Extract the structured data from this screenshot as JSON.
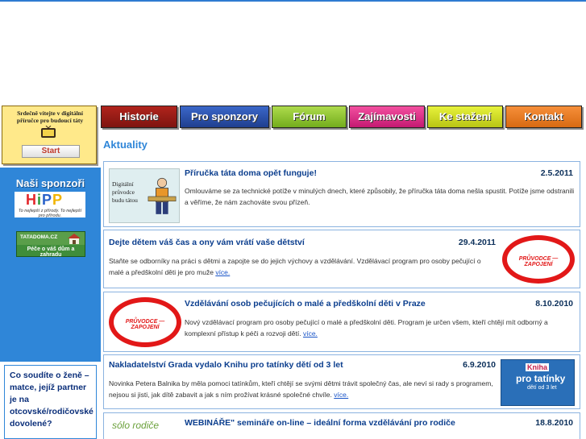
{
  "welcome": {
    "text": "Srdečně vítejte v digitální příručce pro budoucí táty",
    "start_label": "Start"
  },
  "sidebar": {
    "sponsors_heading": "Naši sponzoři",
    "hipp": {
      "name": "HiPP",
      "tagline": "To nejlepší z přírody. To nejlepší pro přírodu."
    },
    "tatadoma": {
      "title": "TATADOMA.CZ",
      "tagline": "Péče o váš dům a zahradu"
    },
    "poll": {
      "question": "Co soudíte o ženě – matce, jejíž partner je na otcovské/rodičovské dovolené?"
    }
  },
  "nav": {
    "items": [
      "Historie",
      "Pro sponzory",
      "Fórum",
      "Zajímavosti",
      "Ke stažení",
      "Kontakt"
    ]
  },
  "main": {
    "section_title": "Aktuality",
    "more_label": "více.",
    "news": [
      {
        "title": "Příručka táta doma opět funguje!",
        "date": "2.5.2011",
        "body": "Omlouváme se za technické potíže v minulých dnech, které způsobily, že příručka táta doma nešla spustit. Potíže jsme odstranili a věříme, že nám zachováte svou přízeň.",
        "thumb_text": "Digitální průvodce budu tátou"
      },
      {
        "title": "Dejte dětem váš čas a ony vám vrátí vaše dětství",
        "date": "29.4.2011",
        "body": "Staňte se odborníky na práci s dětmi a zapojte se do jejich výchovy a vzdělávání. Vzdělávací program pro osoby pečující o malé a předškolní děti je pro muže",
        "logo_text": "PRŮVODCE — ZAPOJENÍ"
      },
      {
        "title": "Vzdělávání osob pečujících o malé a předškolní děti v Praze",
        "date": "8.10.2010",
        "body": "Nový vzdělávací program pro osoby pečující o malé a předškolní děti. Program je určen všem, kteří chtějí mít odborný a komplexní přístup k péči a rozvoji dětí.",
        "logo_text": "PRŮVODCE — ZAPOJENÍ"
      },
      {
        "title": "Nakladatelství Grada vydalo Knihu pro tatínky dětí od 3 let",
        "date": "6.9.2010",
        "body": "Novinka Petera Balnika by měla pomoci tatínkům, kteří chtějí se svými dětmi trávit společný čas, ale neví si rady s programem, nejsou si jisti, jak dítě zabavit a jak s ním prožívat krásné společné chvíle.",
        "book_title_1": "Kniha",
        "book_title_2": "pro tatínky",
        "book_sub": "dětí od 3 let"
      },
      {
        "title": "WEBINÁŘE\" semináře on-line – ideální forma vzdělávání pro rodiče",
        "date": "18.8.2010",
        "logo_text": "sólo rodiče"
      }
    ]
  },
  "colors": {
    "accent_blue": "#2f86d8",
    "title_blue": "#0b3e8e",
    "logo_red": "#e21818"
  }
}
